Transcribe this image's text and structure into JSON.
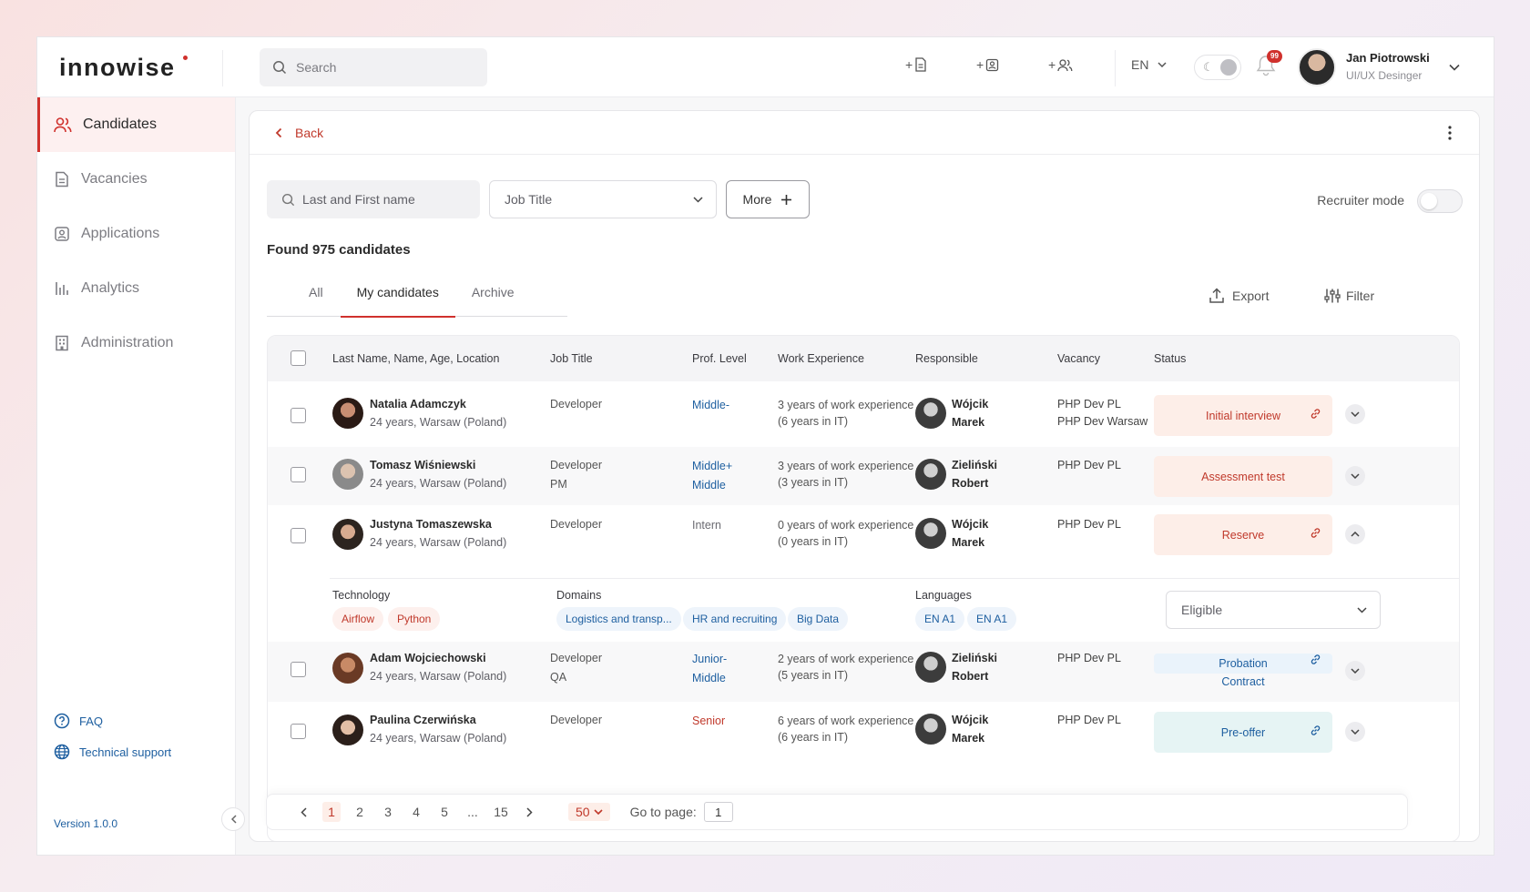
{
  "header": {
    "logo": "innowise",
    "search_placeholder": "Search",
    "lang": "EN",
    "notifications_count": "99",
    "user": {
      "name": "Jan Piotrowski",
      "role": "UI/UX Desinger"
    }
  },
  "sidebar": {
    "items": [
      {
        "label": "Candidates",
        "icon": "users-icon",
        "active": true
      },
      {
        "label": "Vacancies",
        "icon": "document-icon"
      },
      {
        "label": "Applications",
        "icon": "id-badge-icon"
      },
      {
        "label": "Analytics",
        "icon": "bar-chart-icon"
      },
      {
        "label": "Administration",
        "icon": "building-icon"
      }
    ],
    "faq": "FAQ",
    "support": "Technical support",
    "version": "Version  1.0.0"
  },
  "panel": {
    "back": "Back",
    "name_placeholder": "Last and First name",
    "job_title": "Job Title",
    "more": "More",
    "recruiter_mode": "Recruiter mode",
    "found": "Found 975 candidates",
    "tabs": [
      "All",
      "My candidates",
      "Archive"
    ],
    "export": "Export",
    "filter": "Filter"
  },
  "table": {
    "headers": [
      "Last Name, Name, Age, Location",
      "Job Title",
      "Prof. Level",
      "Work Experience",
      "Responsible",
      "Vacancy",
      "Status"
    ],
    "rows": [
      {
        "name": "Natalia Adamczyk",
        "sub": "24 years, Warsaw (Poland)",
        "job1": "Developer",
        "job2": "",
        "level1": "Middle-",
        "level2": "",
        "level_color": "#1e5fa0",
        "exp1": "3 years of work experience",
        "exp2": "(6 years in IT)",
        "resp1": "Wójcik",
        "resp2": "Marek",
        "vac1": "PHP Dev PL",
        "vac2": "PHP Dev Warsaw",
        "status": "Initial interview",
        "status2": ""
      },
      {
        "name": "Tomasz Wiśniewski",
        "sub": "24 years, Warsaw (Poland)",
        "job1": "Developer",
        "job2": "PM",
        "level1": "Middle+",
        "level2": "Middle",
        "level_color": "#1e5fa0",
        "exp1": "3 years of work experience",
        "exp2": "(3 years in IT)",
        "resp1": "Zieliński",
        "resp2": "Robert",
        "vac1": "PHP Dev PL",
        "vac2": "",
        "status": "Assessment test",
        "status2": ""
      },
      {
        "name": "Justyna Tomaszewska",
        "sub": "24 years, Warsaw (Poland)",
        "job1": "Developer",
        "job2": "",
        "level1": "Intern",
        "level2": "",
        "level_color": "#6b6b72",
        "exp1": "0 years of work experience",
        "exp2": "(0 years in IT)",
        "resp1": "Wójcik",
        "resp2": "Marek",
        "vac1": "PHP Dev PL",
        "vac2": "",
        "status": "Reserve",
        "status2": ""
      },
      {
        "name": "Adam Wojciechowski",
        "sub": "24 years, Warsaw (Poland)",
        "job1": "Developer",
        "job2": "QA",
        "level1": "Junior-",
        "level2": "Middle",
        "level_color": "#1e5fa0",
        "exp1": "2 years of work experience",
        "exp2": "(5 years in IT)",
        "resp1": "Zieliński",
        "resp2": "Robert",
        "vac1": "PHP Dev PL",
        "vac2": "",
        "status": "Probation",
        "status2": "Contract"
      },
      {
        "name": "Paulina Czerwińska",
        "sub": "24 years, Warsaw (Poland)",
        "job1": "Developer",
        "job2": "",
        "level1": "Senior",
        "level2": "",
        "level_color": "#c0392b",
        "exp1": "6 years of work experience",
        "exp2": "(6 years in IT)",
        "resp1": "Wójcik",
        "resp2": "Marek",
        "vac1": "PHP Dev PL",
        "vac2": "",
        "status": "Pre-offer",
        "status2": ""
      }
    ],
    "detail": {
      "technology_label": "Technology",
      "technologies": [
        "Airflow",
        "Python"
      ],
      "domains_label": "Domains",
      "domains": [
        "Logistics and transp...",
        "HR and recruiting",
        "Big Data"
      ],
      "languages_label": "Languages",
      "languages": [
        "EN  A1",
        "EN  A1"
      ],
      "eligibility": "Eligible"
    }
  },
  "pagination": {
    "pages": [
      "1",
      "2",
      "3",
      "4",
      "5",
      "...",
      "15"
    ],
    "current": "1",
    "page_size": "50",
    "goto_label": "Go to page:",
    "goto_value": "1"
  }
}
